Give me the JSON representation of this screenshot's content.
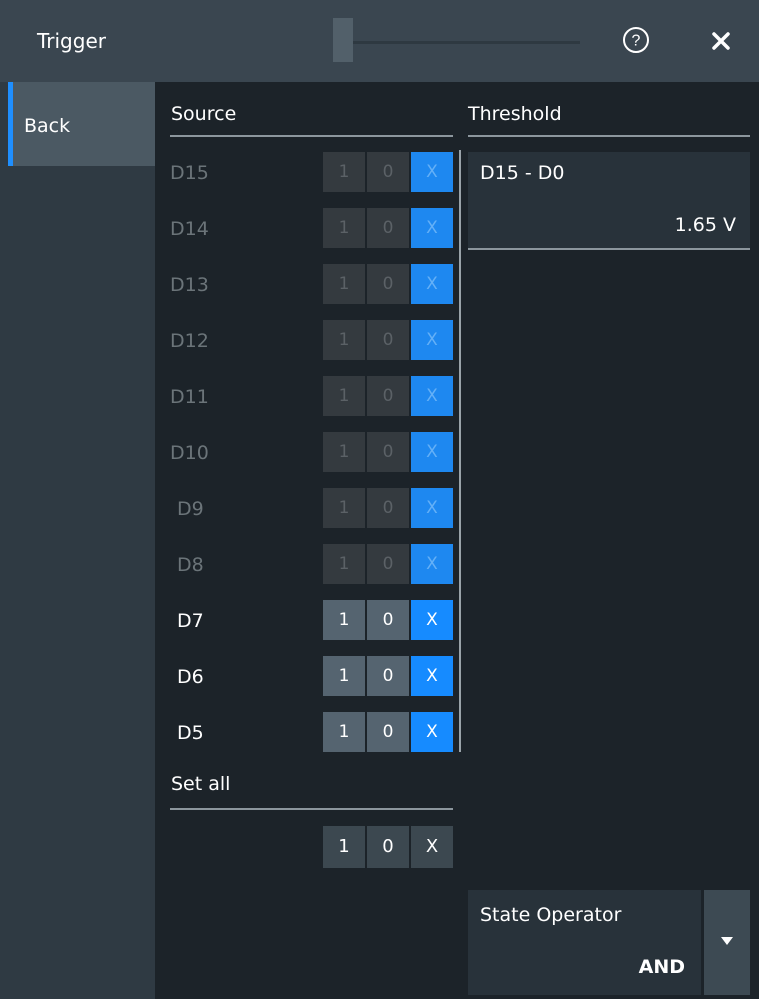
{
  "header": {
    "title": "Trigger"
  },
  "sidebar": {
    "back_label": "Back"
  },
  "source": {
    "heading": "Source",
    "rows": [
      {
        "name": "D15",
        "enabled": false,
        "selected": "X"
      },
      {
        "name": "D14",
        "enabled": false,
        "selected": "X"
      },
      {
        "name": "D13",
        "enabled": false,
        "selected": "X"
      },
      {
        "name": "D12",
        "enabled": false,
        "selected": "X"
      },
      {
        "name": "D11",
        "enabled": false,
        "selected": "X"
      },
      {
        "name": "D10",
        "enabled": false,
        "selected": "X"
      },
      {
        "name": "D9",
        "enabled": false,
        "selected": "X"
      },
      {
        "name": "D8",
        "enabled": false,
        "selected": "X"
      },
      {
        "name": "D7",
        "enabled": true,
        "selected": "X"
      },
      {
        "name": "D6",
        "enabled": true,
        "selected": "X"
      },
      {
        "name": "D5",
        "enabled": true,
        "selected": "X"
      }
    ],
    "options": [
      "1",
      "0",
      "X"
    ]
  },
  "set_all": {
    "heading": "Set all",
    "options": [
      "1",
      "0",
      "X"
    ]
  },
  "threshold": {
    "heading": "Threshold",
    "channel": "D15 - D0",
    "value": "1.65 V"
  },
  "state_operator": {
    "label": "State Operator",
    "value": "AND"
  },
  "colors": {
    "accent": "#1f8fff",
    "selected": "#168bff",
    "background": "#1c2329"
  },
  "icons": {
    "help": "help-circle-icon",
    "close": "close-icon",
    "dropdown": "caret-down-icon"
  }
}
